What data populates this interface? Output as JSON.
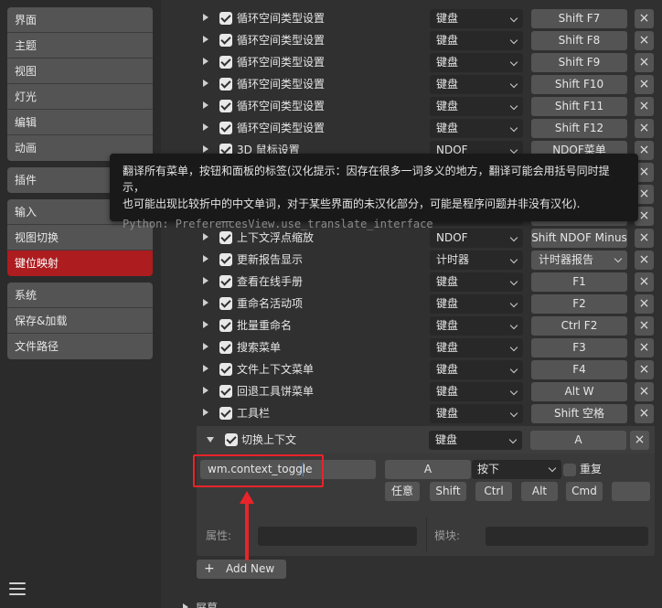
{
  "sidebar": {
    "group1": [
      "界面",
      "主题",
      "视图",
      "灯光",
      "编辑",
      "动画"
    ],
    "group2": [
      "插件"
    ],
    "group3": [
      "输入",
      "视图切换",
      "键位映射"
    ],
    "active": "键位映射",
    "group4": [
      "系统",
      "保存&加载",
      "文件路径"
    ]
  },
  "rows": [
    {
      "name": "循环空间类型设置",
      "type": "键盘",
      "key": "Shift F7"
    },
    {
      "name": "循环空间类型设置",
      "type": "键盘",
      "key": "Shift F8"
    },
    {
      "name": "循环空间类型设置",
      "type": "键盘",
      "key": "Shift F9"
    },
    {
      "name": "循环空间类型设置",
      "type": "键盘",
      "key": "Shift F10"
    },
    {
      "name": "循环空间类型设置",
      "type": "键盘",
      "key": "Shift F11"
    },
    {
      "name": "循环空间类型设置",
      "type": "键盘",
      "key": "Shift F12"
    },
    {
      "name": "3D 鼠标设置",
      "type": "NDOF",
      "key": "NDOF菜单"
    },
    {
      "name": "",
      "type": "",
      "key": ""
    },
    {
      "name": "",
      "type": "",
      "key": ""
    },
    {
      "name": "",
      "type": "NDOF",
      "key": "Shift NDOF Plus"
    },
    {
      "name": "上下文浮点缩放",
      "type": "NDOF",
      "key": "Shift NDOF Minus"
    },
    {
      "name": "更新报告显示",
      "type": "计时器",
      "key": "计时器报告"
    },
    {
      "name": "查看在线手册",
      "type": "键盘",
      "key": "F1"
    },
    {
      "name": "重命名活动项",
      "type": "键盘",
      "key": "F2"
    },
    {
      "name": "批量重命名",
      "type": "键盘",
      "key": "Ctrl F2"
    },
    {
      "name": "搜索菜单",
      "type": "键盘",
      "key": "F3"
    },
    {
      "name": "文件上下文菜单",
      "type": "键盘",
      "key": "F4"
    },
    {
      "name": "回退工具饼菜单",
      "type": "键盘",
      "key": "Alt W"
    },
    {
      "name": "工具栏",
      "type": "键盘",
      "key": "Shift 空格"
    }
  ],
  "tooltip": {
    "line1": "翻译所有菜单，按钮和面板的标签(汉化提示：因存在很多一词多义的地方，翻译可能会用括号同时提示，",
    "line2": "也可能出现比较折中的中文单词，对于某些界面的未汉化部分，可能是程序问题并非没有汉化).",
    "python": "Python: PreferencesView.use_translate_interface"
  },
  "expanded": {
    "name": "切换上下文",
    "type": "键盘",
    "key": "A",
    "identifier": "wm.context_toggle",
    "event_key": "A",
    "event_value": "按下",
    "repeat_label": "重复",
    "modifiers": {
      "any": "任意",
      "shift": "Shift",
      "ctrl": "Ctrl",
      "alt": "Alt",
      "cmd": "Cmd"
    },
    "properties_label": "属性:",
    "module_label": "模块:"
  },
  "add_new": "Add New",
  "bottom_section": "屏幕",
  "icons": {
    "close": "×",
    "plus": "+"
  }
}
